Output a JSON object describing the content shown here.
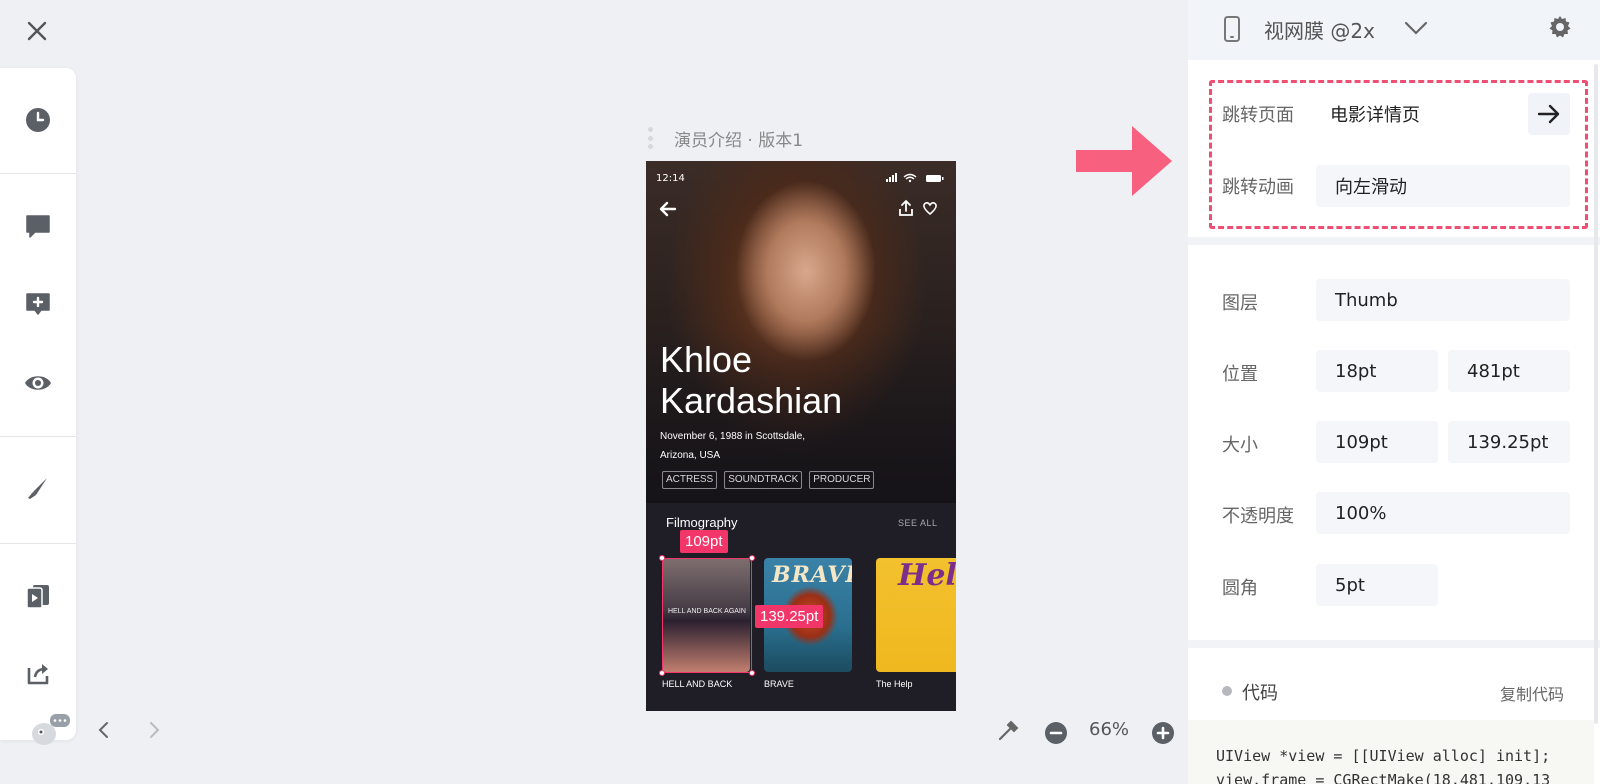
{
  "close_icon": "close-icon",
  "toolbar": {
    "items": [
      {
        "name": "history",
        "icon": "clock-icon"
      },
      {
        "name": "comments",
        "icon": "comment-icon"
      },
      {
        "name": "add-comment",
        "icon": "comment-plus-icon"
      },
      {
        "name": "preview",
        "icon": "eye-icon"
      },
      {
        "name": "slice",
        "icon": "knife-icon"
      },
      {
        "name": "prototype",
        "icon": "cards-play-icon"
      },
      {
        "name": "share",
        "icon": "export-icon"
      }
    ]
  },
  "artboard": {
    "title": "演员介绍 · 版本1"
  },
  "phone": {
    "status_time": "12:14",
    "actor_name_line1": "Khloe",
    "actor_name_line2": "Kardashian",
    "birth_line1": "November 6, 1988 in Scottsdale,",
    "birth_line2": "Arizona, USA",
    "tags": [
      "ACTRESS",
      "SOUNDTRACK",
      "PRODUCER"
    ],
    "section_title": "Filmography",
    "see_all": "SEE ALL",
    "films": [
      {
        "title": "HELL AND BACK",
        "poster_text": "HELL AND BACK AGAIN"
      },
      {
        "title": "BRAVE",
        "poster_text": "BRAVE"
      },
      {
        "title": "The Help",
        "poster_text": "Help"
      }
    ]
  },
  "measurements": {
    "width": "109pt",
    "height": "139.25pt"
  },
  "bottom_bar": {
    "zoom": "66%"
  },
  "panel": {
    "device": "视网膜 @2x",
    "link_label": "跳转页面",
    "link_value": "电影详情页",
    "anim_label": "跳转动画",
    "anim_value": "向左滑动",
    "layer_label": "图层",
    "layer_value": "Thumb",
    "position_label": "位置",
    "pos_x": "18pt",
    "pos_y": "481pt",
    "size_label": "大小",
    "size_w": "109pt",
    "size_h": "139.25pt",
    "opacity_label": "不透明度",
    "opacity_value": "100%",
    "radius_label": "圆角",
    "radius_value": "5pt",
    "code_title": "代码",
    "copy_code": "复制代码",
    "code_line1": "UIView *view = [[UIView alloc] init];",
    "code_line2": "view.frame = CGRectMake(18,481,109,13"
  },
  "colors": {
    "accent": "#f2366a",
    "dashed": "#ee4f72",
    "arrow": "#f7607f"
  }
}
